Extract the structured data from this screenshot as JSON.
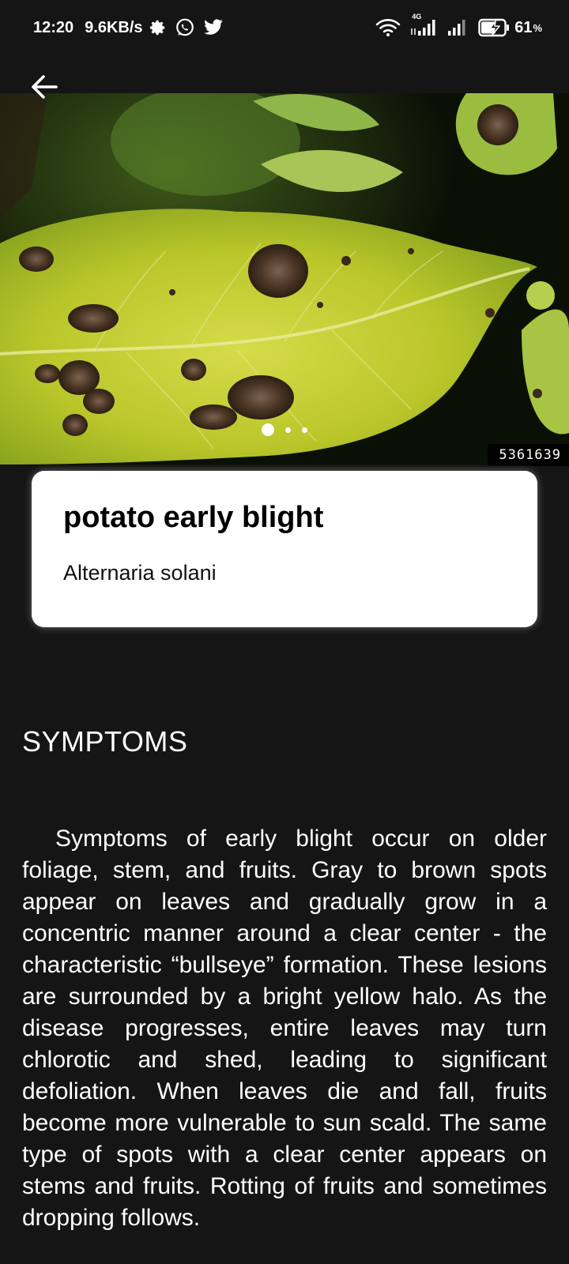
{
  "status_bar": {
    "time": "12:20",
    "speed": "9.6KB/s",
    "network_type": "4G",
    "battery_percent": "61",
    "battery_unit": "%"
  },
  "hero": {
    "image_id": "5361639",
    "carousel_total": 3,
    "carousel_active": 1
  },
  "disease": {
    "name": "potato early blight",
    "scientific_name": "Alternaria solani"
  },
  "section": {
    "heading": "SYMPTOMS",
    "body": "Symptoms of early blight occur on older foliage, stem, and fruits. Gray to brown spots appear on leaves and gradually grow in a concentric manner around a clear center - the characteristic “bullseye” formation. These lesions are surrounded by a bright yellow halo. As the disease progresses, entire leaves may turn chlorotic and shed, leading to significant defoliation. When leaves die and fall, fruits become more vulnerable to sun scald. The same type of spots with a clear center appears on stems and fruits. Rotting of fruits and sometimes dropping follows."
  },
  "icons": {
    "back": "arrow-left-icon",
    "settings": "gear-icon",
    "whatsapp": "whatsapp-icon",
    "twitter": "twitter-icon",
    "wifi": "wifi-icon",
    "signal": "signal-icon",
    "battery": "battery-charging-icon"
  },
  "colors": {
    "background": "#151515",
    "card": "#ffffff",
    "leaf_yellow": "#c9d22c",
    "lesion_brown": "#4a3524"
  }
}
